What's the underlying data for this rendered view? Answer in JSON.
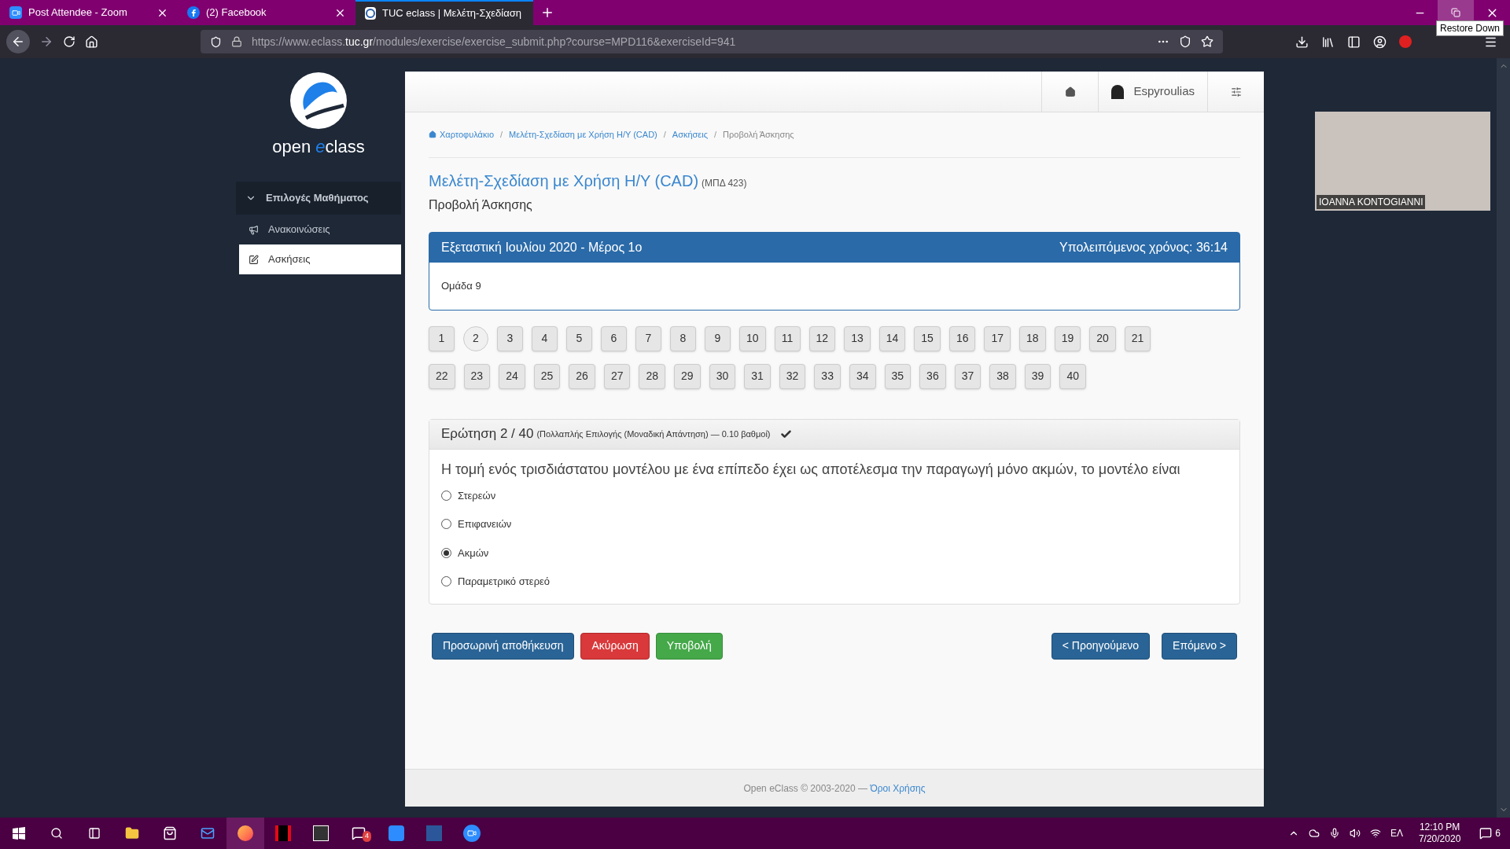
{
  "browser": {
    "tabs": [
      {
        "title": "Post Attendee - Zoom",
        "selected": false,
        "kind": "zoom"
      },
      {
        "title": "(2) Facebook",
        "selected": false,
        "kind": "facebook"
      },
      {
        "title": "TUC eclass | Μελέτη-Σχεδίαση",
        "selected": true,
        "kind": "eclass"
      }
    ],
    "url_prefix": "https://www.eclass.",
    "url_domain": "tuc.gr",
    "url_rest": "/modules/exercise/exercise_submit.php?course=MPD116&exerciseId=941",
    "tooltip": "Restore Down"
  },
  "sidebar": {
    "logo_text_1": "open ",
    "logo_text_2": "e",
    "logo_text_3": "class",
    "section": "Επιλογές Μαθήματος",
    "items": [
      {
        "label": "Ανακοινώσεις",
        "selected": false,
        "kind": "announce"
      },
      {
        "label": "Ασκήσεις",
        "selected": true,
        "kind": "exercise"
      }
    ]
  },
  "header": {
    "user": "Espyroulias"
  },
  "breadcrumb_separator": "/",
  "breadcrumb": [
    "Χαρτοφυλάκιο",
    "Μελέτη-Σχεδίαση με Χρήση Η/Υ (CAD)",
    "Ασκήσεις",
    "Προβολή Άσκησης"
  ],
  "course": {
    "title": "Μελέτη-Σχεδίαση με Χρήση Η/Υ (CAD)",
    "code": "(ΜΠΔ 423)",
    "subtitle": "Προβολή Άσκησης"
  },
  "exam": {
    "title": "Εξεταστική Ιουλίου 2020 - Μέρος 1ο",
    "timer": "Υπολειπόμενος χρόνος: 36:14",
    "group": "Ομάδα 9"
  },
  "questions": [
    {
      "n": "1",
      "selected": false
    },
    {
      "n": "2",
      "selected": true
    },
    {
      "n": "3",
      "selected": false
    },
    {
      "n": "4",
      "selected": false
    },
    {
      "n": "5",
      "selected": false
    },
    {
      "n": "6",
      "selected": false
    },
    {
      "n": "7",
      "selected": false
    },
    {
      "n": "8",
      "selected": false
    },
    {
      "n": "9",
      "selected": false
    },
    {
      "n": "10",
      "selected": false
    },
    {
      "n": "11",
      "selected": false
    },
    {
      "n": "12",
      "selected": false
    },
    {
      "n": "13",
      "selected": false
    },
    {
      "n": "14",
      "selected": false
    },
    {
      "n": "15",
      "selected": false
    },
    {
      "n": "16",
      "selected": false
    },
    {
      "n": "17",
      "selected": false
    },
    {
      "n": "18",
      "selected": false
    },
    {
      "n": "19",
      "selected": false
    },
    {
      "n": "20",
      "selected": false
    },
    {
      "n": "21",
      "selected": false
    },
    {
      "n": "22",
      "selected": false
    },
    {
      "n": "23",
      "selected": false
    },
    {
      "n": "24",
      "selected": false
    },
    {
      "n": "25",
      "selected": false
    },
    {
      "n": "26",
      "selected": false
    },
    {
      "n": "27",
      "selected": false
    },
    {
      "n": "28",
      "selected": false
    },
    {
      "n": "29",
      "selected": false
    },
    {
      "n": "30",
      "selected": false
    },
    {
      "n": "31",
      "selected": false
    },
    {
      "n": "32",
      "selected": false
    },
    {
      "n": "33",
      "selected": false
    },
    {
      "n": "34",
      "selected": false
    },
    {
      "n": "35",
      "selected": false
    },
    {
      "n": "36",
      "selected": false
    },
    {
      "n": "37",
      "selected": false
    },
    {
      "n": "38",
      "selected": false
    },
    {
      "n": "39",
      "selected": false
    },
    {
      "n": "40",
      "selected": false
    }
  ],
  "question": {
    "heading": "Ερώτηση 2 / 40",
    "meta": "(Πολλαπλής Επιλογής (Μοναδική Απάντηση) — 0.10 βαθμοί)",
    "answered": true,
    "text": "Η τομή ενός τρισδιάστατου μοντέλου με ένα επίπεδο έχει ως αποτέλεσμα την παραγωγή μόνο ακμών, το μοντέλο είναι",
    "options": [
      {
        "label": "Στερεών",
        "selected": false
      },
      {
        "label": "Επιφανειών",
        "selected": false
      },
      {
        "label": "Ακμών",
        "selected": true
      },
      {
        "label": "Παραμετρικό στερεό",
        "selected": false
      }
    ]
  },
  "buttons": [
    {
      "label": "Προσωρινή αποθήκευση",
      "kind": "primary"
    },
    {
      "label": "Ακύρωση",
      "kind": "danger"
    },
    {
      "label": "Υποβολή",
      "kind": "success"
    },
    {
      "label": "< Προηγούμενο",
      "kind": "nav"
    },
    {
      "label": "Επόμενο >",
      "kind": "nav"
    }
  ],
  "footer": {
    "text": "Open eClass © 2003-2020 — ",
    "link": "Όροι Χρήσης"
  },
  "video": {
    "name": "IOANNA KONTOGIANNI"
  },
  "taskbar": {
    "badge": "4",
    "lang": "ΕΛ",
    "time": "12:10 PM",
    "date": "7/20/2020",
    "notifications": "6"
  }
}
